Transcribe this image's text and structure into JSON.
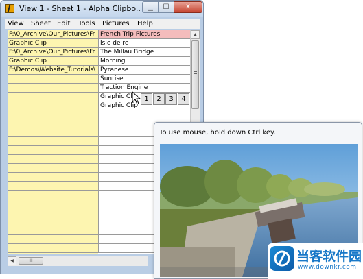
{
  "window": {
    "title": "View 1  -  Sheet 1  -  Alpha Clipbo...",
    "buttons": {
      "minimize": "▁",
      "maximize": "☐",
      "close": "✕"
    }
  },
  "menu": [
    "View",
    "Sheet",
    "Edit",
    "Tools",
    "Pictures",
    "Help"
  ],
  "grid": {
    "rows": [
      {
        "a": "F:\\0_Archive\\Our_Pictures\\Fr",
        "b": "French Trip Pictures"
      },
      {
        "a": "Graphic Clip",
        "b": "Isle de re"
      },
      {
        "a": "F:\\0_Archive\\Our_Pictures\\Fr",
        "b": "The Millau Bridge"
      },
      {
        "a": "Graphic Clip",
        "b": "Morning"
      },
      {
        "a": "F:\\Demos\\Website_Tutorials\\",
        "b": "Pyranese"
      },
      {
        "a": "",
        "b": "Sunrise"
      },
      {
        "a": "",
        "b": "Traction Engine"
      },
      {
        "a": "",
        "b": "Graphic Clip"
      },
      {
        "a": "",
        "b": "Graphic Clip"
      },
      {
        "a": "",
        "b": ""
      },
      {
        "a": "",
        "b": ""
      },
      {
        "a": "",
        "b": ""
      },
      {
        "a": "",
        "b": ""
      },
      {
        "a": "",
        "b": ""
      },
      {
        "a": "",
        "b": ""
      },
      {
        "a": "",
        "b": ""
      },
      {
        "a": "",
        "b": ""
      },
      {
        "a": "",
        "b": ""
      },
      {
        "a": "",
        "b": ""
      },
      {
        "a": "",
        "b": ""
      },
      {
        "a": "",
        "b": ""
      },
      {
        "a": "",
        "b": ""
      },
      {
        "a": "",
        "b": ""
      },
      {
        "a": "",
        "b": ""
      },
      {
        "a": "",
        "b": ""
      }
    ]
  },
  "clip_choices": [
    "1",
    "2",
    "3",
    "4"
  ],
  "scrollbar": {
    "h_thumb": "III"
  },
  "popup": {
    "hint": "To use mouse, hold down Ctrl key."
  },
  "watermark": {
    "text": "当客软件园",
    "url": "www.downkr.com"
  },
  "colors": {
    "column_a_bg": "#fdf5b0",
    "highlight": "#f4bcbc",
    "window_frame": "#b9cde5"
  }
}
